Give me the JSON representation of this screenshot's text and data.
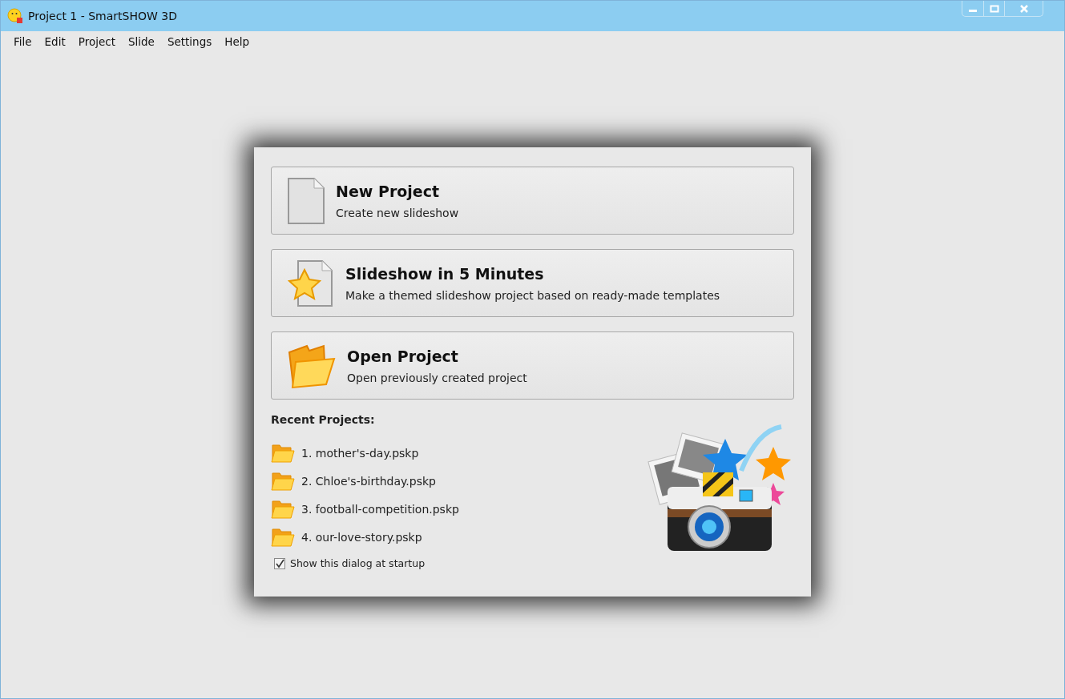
{
  "window": {
    "title": "Project 1 - SmartSHOW 3D"
  },
  "menu": [
    "File",
    "Edit",
    "Project",
    "Slide",
    "Settings",
    "Help"
  ],
  "actions": [
    {
      "kind": "new",
      "title": "New Project",
      "description": "Create new slideshow"
    },
    {
      "kind": "template",
      "title": "Slideshow in 5 Minutes",
      "description": "Make a themed slideshow project based on ready-made templates"
    },
    {
      "kind": "open",
      "title": "Open Project",
      "description": "Open previously created project"
    }
  ],
  "recent": {
    "heading": "Recent Projects:",
    "items": [
      "1. mother's-day.pskp",
      "2. Chloe's-birthday.pskp",
      "3. football-competition.pskp",
      "4. our-love-story.pskp"
    ]
  },
  "startup": {
    "label": "Show this dialog at startup",
    "checked": true
  }
}
